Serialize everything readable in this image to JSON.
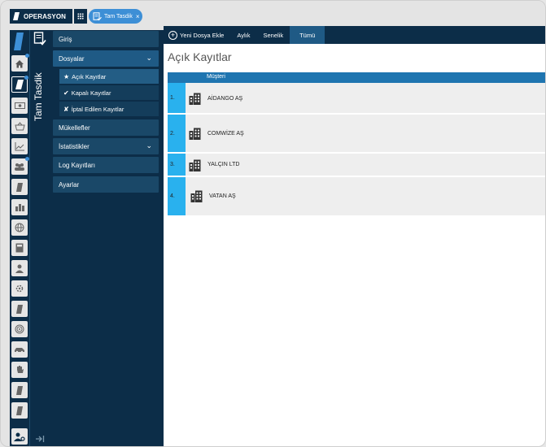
{
  "topbar": {
    "brand": "OPERASYON",
    "tab_label": "Tam Tasdik",
    "tab_close": "×"
  },
  "rail": {
    "icons": [
      "home-icon",
      "document-icon",
      "money-icon",
      "basket-icon",
      "chart-icon",
      "users-icon",
      "document-icon",
      "building-icon",
      "globe-icon",
      "calculator-icon",
      "person-icon",
      "gear-icon",
      "document-icon",
      "target-icon",
      "car-icon",
      "hand-icon",
      "document-icon",
      "document-icon"
    ]
  },
  "vtab": {
    "label": "Tam Tasdik"
  },
  "menu": {
    "items": [
      {
        "label": "Giriş"
      },
      {
        "label": "Dosyalar"
      },
      {
        "label": "Mükellefler"
      },
      {
        "label": "İstatistikler"
      },
      {
        "label": "Log Kayıtları"
      },
      {
        "label": "Ayarlar"
      }
    ],
    "sub": [
      {
        "glyph": "★",
        "label": "Açık Kayıtlar"
      },
      {
        "glyph": "✔",
        "label": "Kapalı Kayıtlar"
      },
      {
        "glyph": "✘",
        "label": "İptal Edilen Kayıtlar"
      }
    ],
    "chevron": "⌄"
  },
  "toolbar": {
    "new_file": "Yeni Dosya Ekle",
    "monthly": "Aylık",
    "yearly": "Senelik",
    "all": "Tümü"
  },
  "main": {
    "title": "Açık Kayıtlar",
    "column_header": "Müşteri",
    "rows": [
      {
        "num": "1.",
        "name": "AİDANGO AŞ"
      },
      {
        "num": "2.",
        "name": "COMWİZE AŞ"
      },
      {
        "num": "3.",
        "name": "YALÇIN LTD"
      },
      {
        "num": "4.",
        "name": "VATAN AŞ"
      }
    ]
  },
  "colors": {
    "navy": "#0c2d48",
    "accent": "#3d8fd6",
    "header_blue": "#1f75b0",
    "row_num": "#29b1ee"
  }
}
